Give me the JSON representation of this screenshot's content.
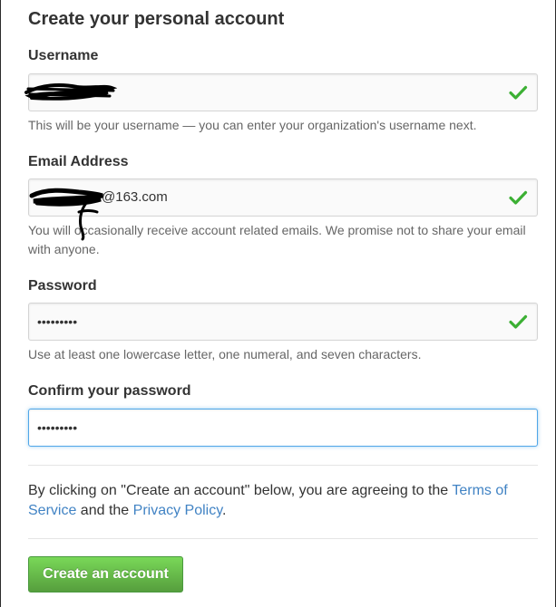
{
  "form": {
    "title": "Create your personal account",
    "username": {
      "label": "Username",
      "value": "",
      "note": "This will be your username — you can enter your organization's username next."
    },
    "email": {
      "label": "Email Address",
      "value": "@163.com",
      "note": "You will occasionally receive account related emails. We promise not to share your email with anyone."
    },
    "password": {
      "label": "Password",
      "value": "•••••••••",
      "note": "Use at least one lowercase letter, one numeral, and seven characters."
    },
    "confirm_password": {
      "label": "Confirm your password",
      "value": "•••••••••"
    },
    "terms": {
      "prefix": "By clicking on \"Create an account\" below, you are agreeing to the ",
      "terms_link": "Terms of Service",
      "middle": " and the ",
      "privacy_link": "Privacy Policy",
      "suffix": "."
    },
    "submit_label": "Create an account"
  },
  "colors": {
    "valid_check": "#3cb034",
    "link": "#4183c4",
    "button": "#60b044",
    "focus_border": "#51a7e8"
  },
  "icons": {
    "valid": "checkmark-icon"
  }
}
